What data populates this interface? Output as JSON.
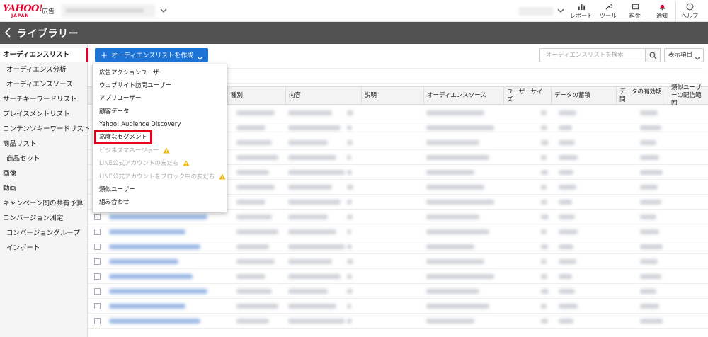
{
  "topbar": {
    "logo_text": "YAHOO!",
    "logo_sub": "JAPAN",
    "logo_ad": "広告",
    "nav": [
      {
        "label": "レポート",
        "icon": "bar-chart-icon"
      },
      {
        "label": "ツール",
        "icon": "wrench-icon"
      },
      {
        "label": "料金",
        "icon": "wallet-icon"
      },
      {
        "label": "通知",
        "icon": "bell-icon"
      },
      {
        "label": "ヘルプ",
        "icon": "question-icon"
      }
    ]
  },
  "header": {
    "title": "ライブラリー"
  },
  "sidebar": {
    "items": [
      {
        "label": "オーディエンスリスト"
      },
      {
        "label": "オーディエンス分析"
      },
      {
        "label": "オーディエンスソース"
      },
      {
        "label": "サーチキーワードリスト"
      },
      {
        "label": "プレイスメントリスト"
      },
      {
        "label": "コンテンツキーワードリスト"
      },
      {
        "label": "商品リスト"
      },
      {
        "label": "商品セット"
      },
      {
        "label": "画像"
      },
      {
        "label": "動画"
      },
      {
        "label": "キャンペーン間の共有予算"
      },
      {
        "label": "コンバージョン測定"
      },
      {
        "label": "コンバージョングループ"
      },
      {
        "label": "インポート"
      }
    ]
  },
  "main": {
    "create_button": "オーディエンスリストを作成",
    "search_placeholder": "オーディエンスリストを検索",
    "columns_button": "表示項目",
    "dropdown": [
      {
        "label": "広告アクションユーザー",
        "disabled": false
      },
      {
        "label": "ウェブサイト訪問ユーザー",
        "disabled": false
      },
      {
        "label": "アプリユーザー",
        "disabled": false
      },
      {
        "label": "顧客データ",
        "disabled": false
      },
      {
        "label": "Yahoo! Audience Discovery",
        "disabled": false
      },
      {
        "label": "高度なセグメント",
        "disabled": false,
        "highlighted": true
      },
      {
        "label": "ビジネスマネージャー",
        "disabled": true
      },
      {
        "label": "LINE公式アカウントの友だち",
        "disabled": true
      },
      {
        "label": "LINE公式アカウントをブロック中の友だち",
        "disabled": true
      },
      {
        "label": "類似ユーザー",
        "disabled": false
      },
      {
        "label": "組み合わせ",
        "disabled": false
      }
    ],
    "table_headers": [
      "種別",
      "内容",
      "説明",
      "オーディエンスソース",
      "ユーザーサイズ",
      "データの蓄積",
      "データの有効期間",
      "類似ユーザーの配信範囲"
    ]
  },
  "colors": {
    "accent": "#1e74d6",
    "brand": "#e4002b",
    "header_bg": "#515151",
    "highlight": "#e2001a",
    "warning": "#f0b400"
  }
}
